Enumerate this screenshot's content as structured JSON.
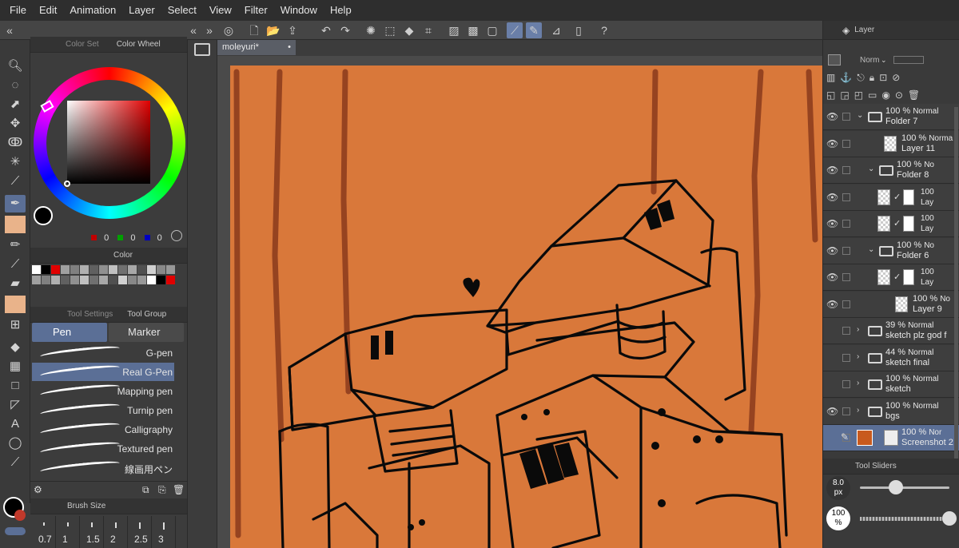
{
  "menu": [
    "File",
    "Edit",
    "Animation",
    "Layer",
    "Select",
    "View",
    "Filter",
    "Window",
    "Help"
  ],
  "left": {
    "tabs": {
      "color_set": "Color Set",
      "color_wheel": "Color Wheel",
      "color": "Color",
      "tool_settings": "Tool Settings",
      "tool_group": "Tool Group",
      "brush_size": "Brush Size"
    },
    "rgb": {
      "r": "0",
      "g": "0",
      "b": "0"
    },
    "subtools": {
      "pen": "Pen",
      "marker": "Marker"
    },
    "brushes": [
      "G-pen",
      "Real G-Pen",
      "Mapping pen",
      "Turnip pen",
      "Calligraphy",
      "Textured pen",
      "線画用ペン"
    ],
    "selected_brush": 1,
    "brush_sizes": [
      "0.7",
      "1",
      "1.5",
      "2",
      "2.5",
      "3"
    ]
  },
  "document": {
    "tab": "moleyuri*",
    "close": "•"
  },
  "right": {
    "tab": "Layer",
    "blend": "Norm",
    "layers": [
      {
        "pct": "100 %",
        "mode": "Normal",
        "name": "Folder 7",
        "kind": "folder",
        "indent": 0,
        "visible": true
      },
      {
        "pct": "100 %",
        "mode": "Norma",
        "name": "Layer 11",
        "kind": "layer",
        "indent": 1,
        "visible": true
      },
      {
        "pct": "100 %",
        "mode": "No",
        "name": "Folder 8",
        "kind": "folder",
        "indent": 1,
        "visible": true
      },
      {
        "pct": "100",
        "mode": "",
        "name": "Lay",
        "kind": "mask",
        "indent": 2,
        "visible": true
      },
      {
        "pct": "100",
        "mode": "",
        "name": "Lay",
        "kind": "mask",
        "indent": 2,
        "visible": true
      },
      {
        "pct": "100 %",
        "mode": "No",
        "name": "Folder 6",
        "kind": "folder",
        "indent": 1,
        "visible": true
      },
      {
        "pct": "100",
        "mode": "",
        "name": "Lay",
        "kind": "mask",
        "indent": 2,
        "visible": true
      },
      {
        "pct": "100 %",
        "mode": "No",
        "name": "Layer 9",
        "kind": "layer",
        "indent": 2,
        "visible": true
      },
      {
        "pct": "39 %",
        "mode": "Normal",
        "name": "sketch plz god f",
        "kind": "folder-closed",
        "indent": 0,
        "visible": false
      },
      {
        "pct": "44 %",
        "mode": "Normal",
        "name": "sketch final",
        "kind": "folder-closed",
        "indent": 0,
        "visible": false
      },
      {
        "pct": "100 %",
        "mode": "Normal",
        "name": "sketch",
        "kind": "folder-closed",
        "indent": 0,
        "visible": false
      },
      {
        "pct": "100 %",
        "mode": "Normal",
        "name": "bgs",
        "kind": "folder-closed",
        "indent": 0,
        "visible": true
      },
      {
        "pct": "100 %",
        "mode": "Nor",
        "name": "Screenshot 2",
        "kind": "image",
        "indent": 0,
        "visible": false,
        "selected": true
      }
    ],
    "tool_sliders": "Tool Sliders",
    "size_value": "8.0",
    "size_unit": "px",
    "opacity_value": "100",
    "opacity_unit": "%",
    "size_level": 0.4,
    "opacity_level": 1.0
  },
  "colors": {
    "canvas_bg": "#d9783a",
    "accent": "#5b6f96",
    "main_color": "#000000"
  },
  "palette": [
    "#ffffff",
    "#000000",
    "#e00000",
    "#a0a0a0",
    "#808080",
    "#b0b0b0",
    "#606060",
    "#909090",
    "#c0c0c0",
    "#707070",
    "#a8a8a8",
    "#505050",
    "#d0d0d0",
    "#888888",
    "#989898"
  ]
}
